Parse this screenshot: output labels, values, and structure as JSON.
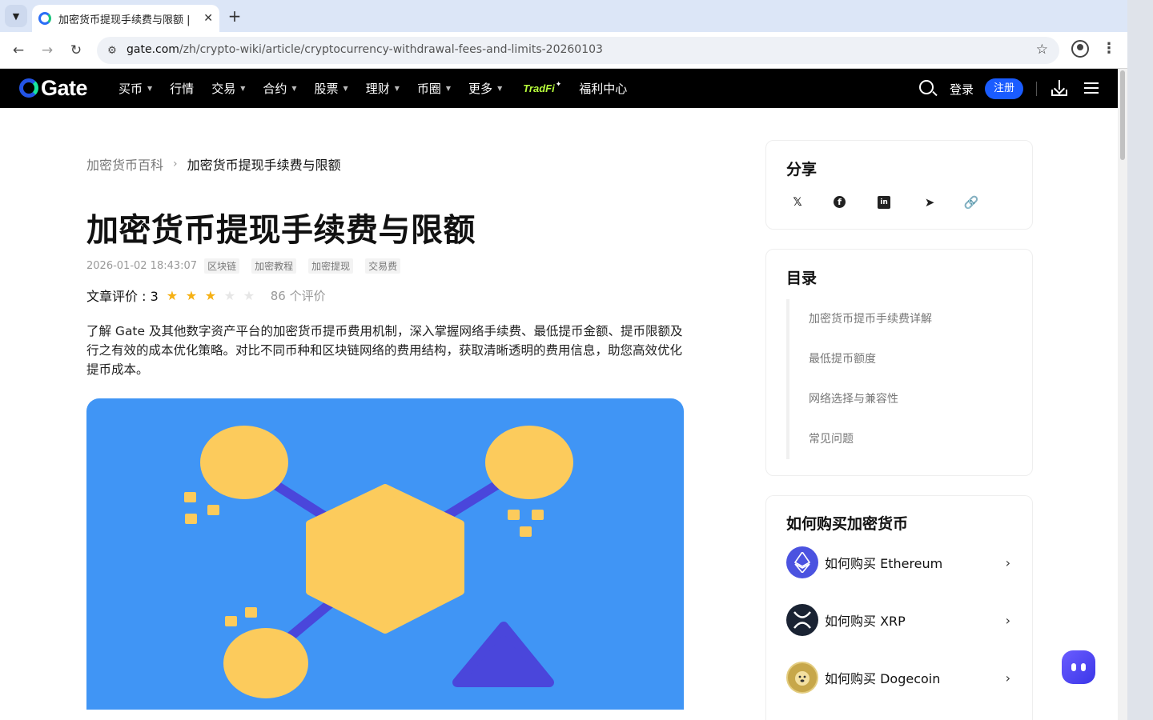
{
  "browser": {
    "tab_title": "加密货币提现手续费与限额 |",
    "url_host": "gate.com",
    "url_path": "/zh/crypto-wiki/article/cryptocurrency-withdrawal-fees-and-limits-20260103"
  },
  "header": {
    "logo_text": "Gate",
    "menu": [
      "买币",
      "行情",
      "交易",
      "合约",
      "股票",
      "理财",
      "币圈",
      "更多"
    ],
    "menu_has_caret": [
      true,
      false,
      true,
      true,
      true,
      true,
      true,
      true
    ],
    "tradfi": "TradFi",
    "welfare": "福利中心",
    "login": "登录",
    "signup": "注册"
  },
  "article": {
    "breadcrumb_home": "加密货币百科",
    "breadcrumb_current": "加密货币提现手续费与限额",
    "title": "加密货币提现手续费与限额",
    "date": "2026-01-02 18:43:07",
    "tags": [
      "区块链",
      "加密教程",
      "加密提现",
      "交易费"
    ],
    "rating_label": "文章评价 : 3",
    "rating": 3,
    "rating_max": 5,
    "rating_count": "86 个评价",
    "summary": "了解 Gate 及其他数字资产平台的加密货币提币费用机制，深入掌握网络手续费、最低提币金额、提币限额及行之有效的成本优化策略。对比不同币种和区块链网络的费用结构，获取清晰透明的费用信息，助您高效优化提币成本。"
  },
  "sidebar": {
    "share_title": "分享",
    "toc_title": "目录",
    "toc": [
      "加密货币提币手续费详解",
      "最低提币额度",
      "网络选择与兼容性",
      "常见问题"
    ],
    "buy_title": "如何购买加密货币",
    "buy_items": [
      {
        "label": "如何购买 Ethereum",
        "icon": "ethereum-icon"
      },
      {
        "label": "如何购买 XRP",
        "icon": "xrp-icon"
      },
      {
        "label": "如何购买 Dogecoin",
        "icon": "dogecoin-icon"
      }
    ]
  },
  "colors": {
    "accent": "#1a5cff",
    "hero_bg": "#4095f5",
    "hero_yellow": "#fccb5c",
    "hero_purple": "#4a46db",
    "star_on": "#f5b013"
  }
}
